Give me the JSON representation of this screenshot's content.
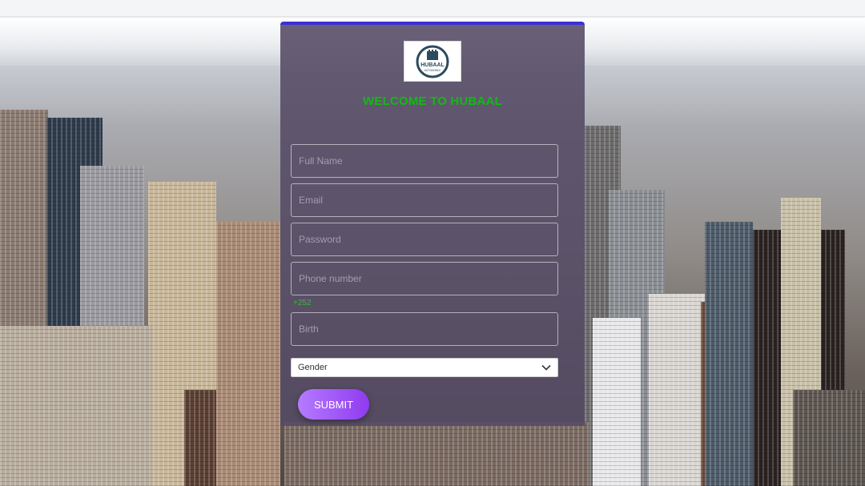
{
  "brand": {
    "logo_text": "HUBAAL",
    "logo_subtext": "AUTOMOBILE"
  },
  "form": {
    "welcome": "WELCOME TO HUBAAL",
    "full_name_placeholder": "Full Name",
    "email_placeholder": "Email",
    "password_placeholder": "Password",
    "phone_placeholder": "Phone number",
    "phone_hint": "+252",
    "birth_placeholder": "Birth",
    "gender_selected": "Gender",
    "submit_label": "SUBMIT"
  },
  "colors": {
    "accent_top_border": "#3d2fd6",
    "welcome_text": "#14b814",
    "submit_gradient_start": "#b57bff",
    "submit_gradient_end": "#8f3bf0"
  },
  "icons": {
    "select_arrow": "chevron-down-icon"
  }
}
